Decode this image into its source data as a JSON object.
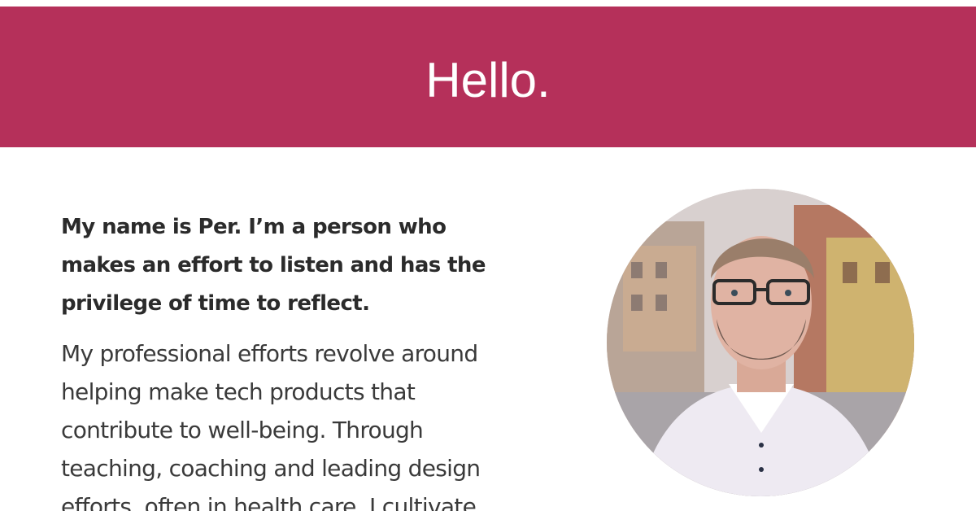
{
  "header": {
    "title": "Hello.",
    "background_color": "#b5305a"
  },
  "intro": {
    "lead": "My name is Per. I’m a person who makes an effort to listen and has the privilege of time to reflect.",
    "body": "My professional efforts revolve around helping make tech products that contribute to well-being. Through teaching, coaching and leading design efforts, often in health care, I cultivate"
  },
  "avatar": {
    "icon": "portrait-photo"
  }
}
